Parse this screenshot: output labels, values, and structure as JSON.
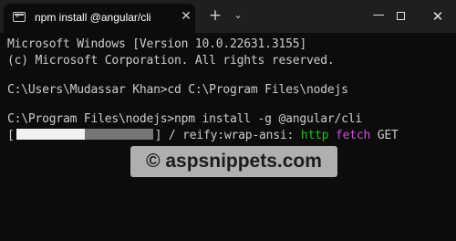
{
  "window": {
    "tab_title": "npm install @angular/cli",
    "tab_close_glyph": "✕",
    "new_tab_glyph": "+",
    "dropdown_glyph": "⌄",
    "minimize_glyph": "—",
    "close_glyph": "✕"
  },
  "terminal": {
    "line1": "Microsoft Windows [Version 10.0.22631.3155]",
    "line2": "(c) Microsoft Corporation. All rights reserved.",
    "line3": "C:\\Users\\Mudassar Khan>cd C:\\Program Files\\nodejs",
    "line4": "C:\\Program Files\\nodejs>npm install -g @angular/cli",
    "progress": {
      "open_bracket": "[",
      "close_bracket": "]",
      "fraction_complete": 0.5,
      "status_prefix": " / reify:wrap-ansi: ",
      "status_http": "http",
      "status_fetch": "fetch",
      "status_method": "GET"
    }
  },
  "watermark": "© aspsnippets.com",
  "colors": {
    "background": "#0c0c0c",
    "titlebar": "#1f1f1f",
    "text": "#cccccc",
    "http": "#16c60c",
    "fetch": "#c94fd8"
  },
  "icons": [
    "terminal-icon",
    "close-icon",
    "plus-icon",
    "chevron-down-icon",
    "minimize-icon",
    "maximize-icon"
  ]
}
